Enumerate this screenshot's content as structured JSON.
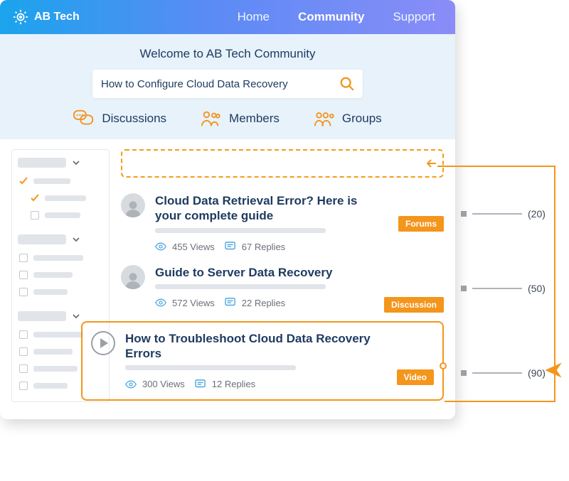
{
  "brand": "AB Tech",
  "nav": {
    "home": "Home",
    "community": "Community",
    "support": "Support"
  },
  "welcome": "Welcome to AB Tech Community",
  "search": {
    "value": "How to Configure Cloud Data Recovery"
  },
  "categories": {
    "discussions": "Discussions",
    "members": "Members",
    "groups": "Groups"
  },
  "items": [
    {
      "title": "Cloud Data Retrieval Error? Here is your complete guide",
      "views": "455 Views",
      "replies": "67 Replies",
      "tag": "Forums"
    },
    {
      "title": "Guide to Server Data Recovery",
      "views": "572 Views",
      "replies": "22 Replies",
      "tag": "Discussion"
    },
    {
      "title": "How to Troubleshoot Cloud Data Recovery Errors",
      "views": "300 Views",
      "replies": "12 Replies",
      "tag": "Video"
    }
  ],
  "annotations": {
    "a1": "(20)",
    "a2": "(50)",
    "a3": "(90)"
  }
}
